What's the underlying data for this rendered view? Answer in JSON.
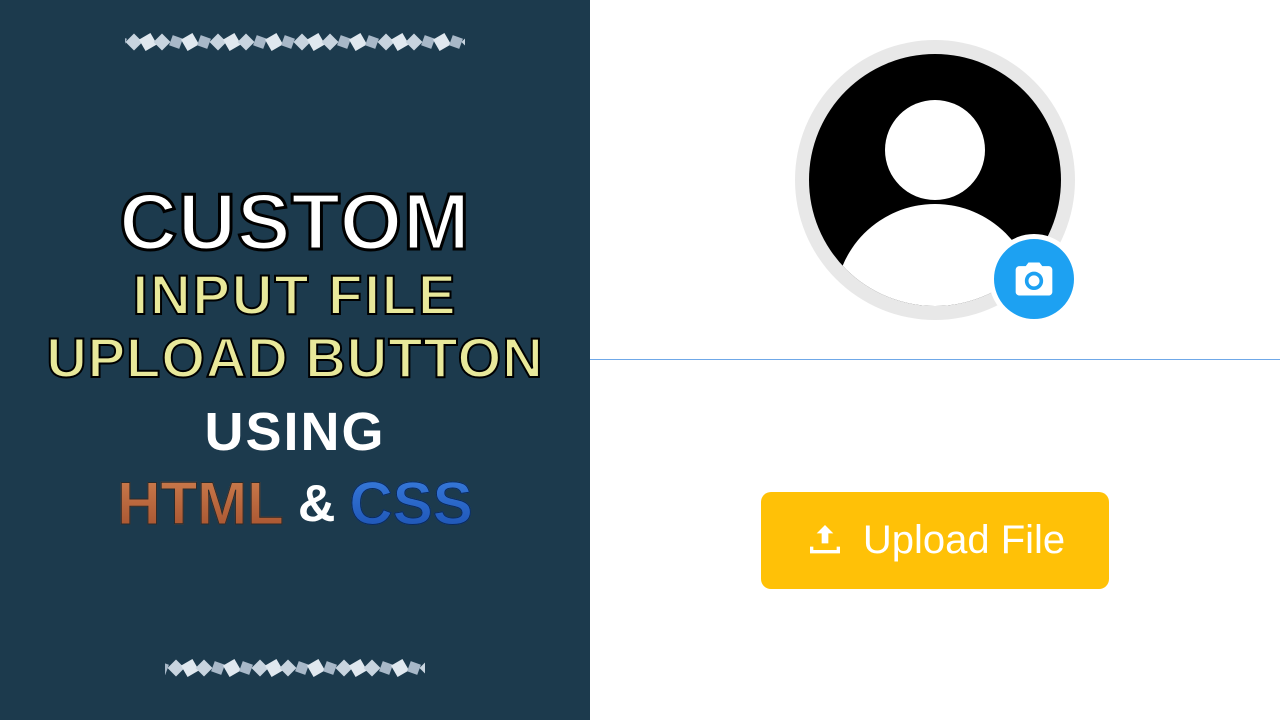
{
  "left": {
    "line1": "CUSTOM",
    "line2": "INPUT FILE",
    "line3": "UPLOAD BUTTON",
    "line4": "USING",
    "lang_html": "HTML",
    "lang_amp": "&",
    "lang_css": "CSS"
  },
  "right": {
    "upload_label": "Upload File"
  },
  "colors": {
    "panel_bg": "#1c3a4d",
    "accent_yellow": "#ffc107",
    "accent_blue": "#1da1f2"
  }
}
